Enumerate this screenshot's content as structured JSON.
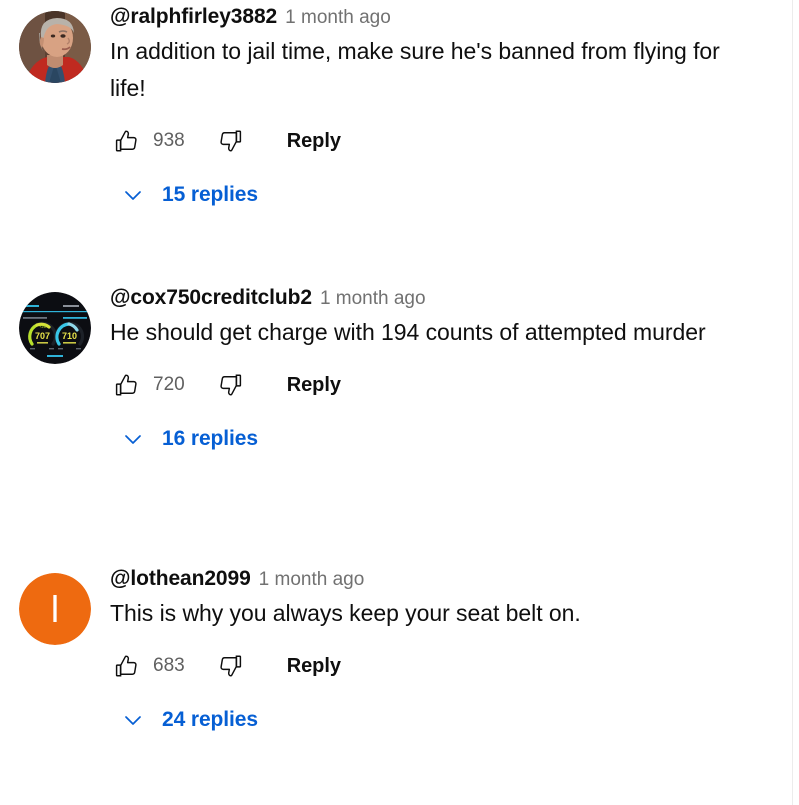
{
  "page": {
    "background_color": "#ffffff",
    "link_color": "#065fd4",
    "text_color": "#0f0f0f",
    "muted_color": "#606060",
    "timestamp_color": "#717171"
  },
  "icons": {
    "like": "thumbs-up-icon",
    "dislike": "thumbs-down-icon",
    "expand": "chevron-down-icon"
  },
  "comments": [
    {
      "author": "@ralphfirley3882",
      "timestamp": "1 month ago",
      "text": "In addition to jail time, make sure he's banned from flying for life!",
      "likes": "938",
      "reply_label": "Reply",
      "replies_label": "15 replies",
      "avatar": {
        "type": "photo",
        "description": "portrait-of-man-in-red-jacket",
        "colors": {
          "background": "#6b4a3a",
          "hair": "#b9b3ab",
          "skin": "#d7a184",
          "jacket": "#c02a20",
          "shirt": "#2e4a68"
        }
      }
    },
    {
      "author": "@cox750creditclub2",
      "timestamp": "1 month ago",
      "text": "He should get charge with 194 counts of attempted murder",
      "likes": "720",
      "reply_label": "Reply",
      "replies_label": "16 replies",
      "avatar": {
        "type": "graphic",
        "description": "credit-score-dashboard",
        "gauge_left_value": "707",
        "gauge_right_value": "710",
        "colors": {
          "background": "#0c0d12",
          "accent": "#2fb3d9",
          "gauge_left": "#b8e02c",
          "gauge_right": "#38c6e8",
          "value_text": "#e8e44a"
        }
      }
    },
    {
      "author": "@lothean2099",
      "timestamp": "1 month ago",
      "text": "This is why you always keep your seat belt on.",
      "likes": "683",
      "reply_label": "Reply",
      "replies_label": "24 replies",
      "avatar": {
        "type": "initial",
        "initial": "l",
        "colors": {
          "background": "#ee6a10",
          "text": "#ffffff"
        }
      }
    }
  ]
}
